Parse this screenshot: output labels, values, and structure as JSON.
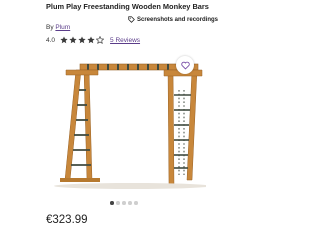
{
  "product": {
    "title": "Plum Play Freestanding Wooden Monkey Bars",
    "by_label": "By",
    "brand": "Plum",
    "rating_value": "4.0",
    "rating_stars": 4,
    "reviews_label": "5 Reviews",
    "price": "€323.99"
  },
  "share": {
    "label": "Screenshots and recordings",
    "icon": "tag-icon"
  },
  "gallery": {
    "image_count": 5,
    "active_index": 0,
    "favourite_icon": "heart-icon"
  },
  "colors": {
    "star": "#3b3b3b",
    "link": "#5b3d8a",
    "favourite": "#7a4fa8",
    "wood": "#c8873b",
    "rungs": "#3f4a3f"
  }
}
